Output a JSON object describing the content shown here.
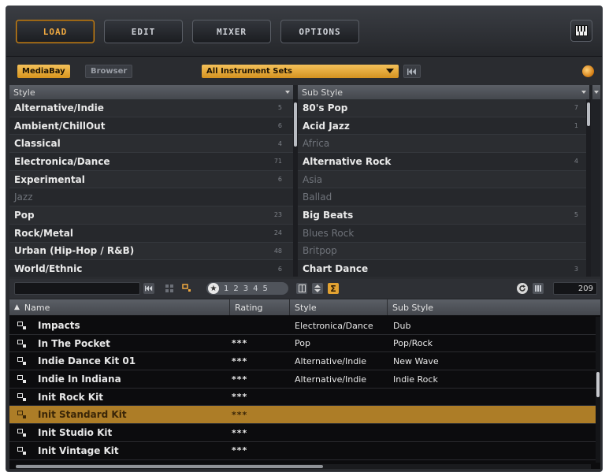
{
  "toolbar": {
    "buttons": [
      {
        "label": "LOAD",
        "active": true
      },
      {
        "label": "EDIT",
        "active": false
      },
      {
        "label": "MIXER",
        "active": false
      },
      {
        "label": "OPTIONS",
        "active": false
      }
    ],
    "keyboard_icon": "keyboard-icon"
  },
  "mediabay": {
    "tabs": [
      "MediaBay",
      "Browser"
    ],
    "active_tab": "MediaBay",
    "set_dropdown": "All Instrument Sets",
    "reset_icon": "rewind-icon"
  },
  "style_column": {
    "header": "Style",
    "items": [
      {
        "label": "Alternative/Indie",
        "count": "5",
        "dim": false
      },
      {
        "label": "Ambient/ChillOut",
        "count": "6",
        "dim": false
      },
      {
        "label": "Classical",
        "count": "4",
        "dim": false
      },
      {
        "label": "Electronica/Dance",
        "count": "71",
        "dim": false
      },
      {
        "label": "Experimental",
        "count": "6",
        "dim": false
      },
      {
        "label": "Jazz",
        "count": "",
        "dim": true
      },
      {
        "label": "Pop",
        "count": "23",
        "dim": false
      },
      {
        "label": "Rock/Metal",
        "count": "24",
        "dim": false
      },
      {
        "label": "Urban (Hip-Hop / R&B)",
        "count": "48",
        "dim": false
      },
      {
        "label": "World/Ethnic",
        "count": "6",
        "dim": false
      }
    ]
  },
  "substyle_column": {
    "header": "Sub Style",
    "items": [
      {
        "label": "80's Pop",
        "count": "7",
        "dim": false
      },
      {
        "label": "Acid Jazz",
        "count": "1",
        "dim": false
      },
      {
        "label": "Africa",
        "count": "",
        "dim": true
      },
      {
        "label": "Alternative Rock",
        "count": "4",
        "dim": false
      },
      {
        "label": "Asia",
        "count": "",
        "dim": true
      },
      {
        "label": "Ballad",
        "count": "",
        "dim": true
      },
      {
        "label": "Big Beats",
        "count": "5",
        "dim": false
      },
      {
        "label": "Blues Rock",
        "count": "",
        "dim": true
      },
      {
        "label": "Britpop",
        "count": "",
        "dim": true
      },
      {
        "label": "Chart Dance",
        "count": "3",
        "dim": false
      }
    ]
  },
  "results_bar": {
    "rating_numbers": [
      "1",
      "2",
      "3",
      "4",
      "5"
    ],
    "sigma_label": "Σ",
    "result_count": "209"
  },
  "results": {
    "columns": [
      "Name",
      "Rating",
      "Style",
      "Sub Style"
    ],
    "rows": [
      {
        "name": "Impacts",
        "rating": "",
        "style": "Electronica/Dance",
        "sub_style": "Dub",
        "selected": false
      },
      {
        "name": "In The Pocket",
        "rating": "***",
        "style": "Pop",
        "sub_style": "Pop/Rock",
        "selected": false
      },
      {
        "name": "Indie Dance Kit 01",
        "rating": "***",
        "style": "Alternative/Indie",
        "sub_style": "New Wave",
        "selected": false
      },
      {
        "name": "Indie In Indiana",
        "rating": "***",
        "style": "Alternative/Indie",
        "sub_style": "Indie Rock",
        "selected": false
      },
      {
        "name": "Init Rock Kit",
        "rating": "***",
        "style": "",
        "sub_style": "",
        "selected": false
      },
      {
        "name": "Init Standard Kit",
        "rating": "***",
        "style": "",
        "sub_style": "",
        "selected": true
      },
      {
        "name": "Init Studio Kit",
        "rating": "***",
        "style": "",
        "sub_style": "",
        "selected": false
      },
      {
        "name": "Init Vintage Kit",
        "rating": "***",
        "style": "",
        "sub_style": "",
        "selected": false
      }
    ]
  },
  "colors": {
    "accent": "#f0a940",
    "selected_row": "#ad7d27",
    "panel": "#2a2c30"
  }
}
